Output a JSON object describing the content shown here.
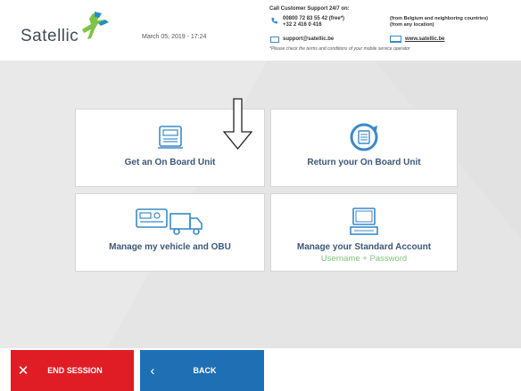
{
  "header": {
    "logo_text": "Satellic",
    "date": "March 05, 2019 - 17:24",
    "support_title": "Call Customer Support 24/7 on:",
    "phone_line1": "00800 72 83 55 42 (free*)",
    "phone_line2": "+32 2 416 0 416",
    "region_line1": "(from Belgium and neighboring countries)",
    "region_line2": "(from any location)",
    "email": "support@satellic.be",
    "website": "www.satellic.be",
    "footnote": "*Please check the terms and conditions of your mobile service operator"
  },
  "tiles": [
    {
      "label": "Get an On Board Unit",
      "icon": "obu-device-icon"
    },
    {
      "label": "Return your On Board Unit",
      "icon": "return-obu-icon"
    },
    {
      "label": "Manage my vehicle and OBU",
      "icon": "truck-obu-icon"
    },
    {
      "label": "Manage your Standard Account",
      "sublabel": "Username + Password",
      "icon": "computer-icon"
    }
  ],
  "footer": {
    "end_session": "END SESSION",
    "back": "BACK"
  },
  "colors": {
    "end_session": "#e01d25",
    "back": "#1f6fb5",
    "tile_text": "#3a5878",
    "sublabel": "#7fc478",
    "background": "#e5e5e5"
  }
}
